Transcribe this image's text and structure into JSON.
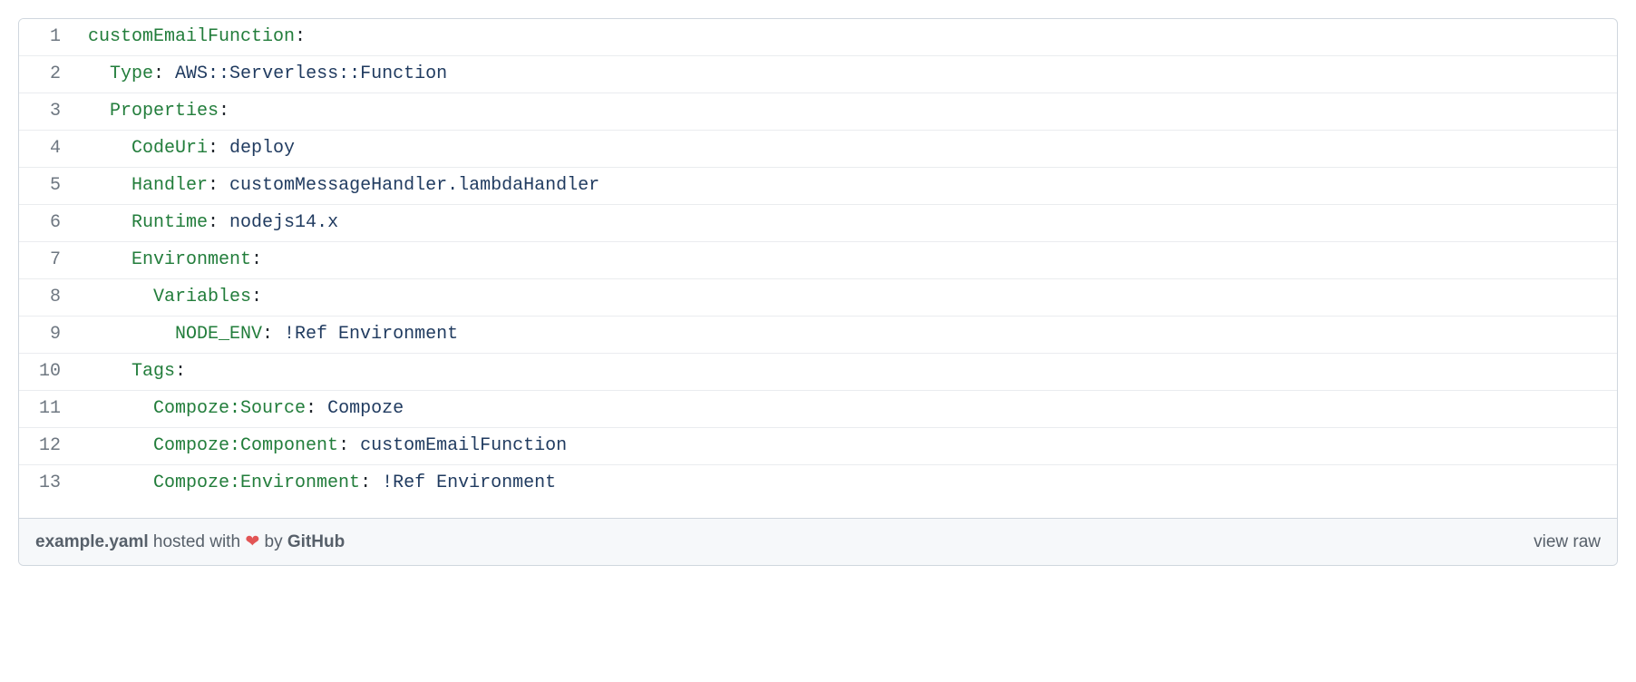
{
  "code": {
    "lines": [
      {
        "n": "1",
        "indent": "",
        "segments": [
          {
            "t": "customEmailFunction",
            "c": "pl-ent"
          },
          {
            "t": ":",
            "c": ""
          }
        ]
      },
      {
        "n": "2",
        "indent": "  ",
        "segments": [
          {
            "t": "Type",
            "c": "pl-ent"
          },
          {
            "t": ": ",
            "c": ""
          },
          {
            "t": "AWS::Serverless::Function",
            "c": "pl-s"
          }
        ]
      },
      {
        "n": "3",
        "indent": "  ",
        "segments": [
          {
            "t": "Properties",
            "c": "pl-ent"
          },
          {
            "t": ":",
            "c": ""
          }
        ]
      },
      {
        "n": "4",
        "indent": "    ",
        "segments": [
          {
            "t": "CodeUri",
            "c": "pl-ent"
          },
          {
            "t": ": ",
            "c": ""
          },
          {
            "t": "deploy",
            "c": "pl-s"
          }
        ]
      },
      {
        "n": "5",
        "indent": "    ",
        "segments": [
          {
            "t": "Handler",
            "c": "pl-ent"
          },
          {
            "t": ": ",
            "c": ""
          },
          {
            "t": "customMessageHandler.lambdaHandler",
            "c": "pl-s"
          }
        ]
      },
      {
        "n": "6",
        "indent": "    ",
        "segments": [
          {
            "t": "Runtime",
            "c": "pl-ent"
          },
          {
            "t": ": ",
            "c": ""
          },
          {
            "t": "nodejs14.x",
            "c": "pl-s"
          }
        ]
      },
      {
        "n": "7",
        "indent": "    ",
        "segments": [
          {
            "t": "Environment",
            "c": "pl-ent"
          },
          {
            "t": ":",
            "c": ""
          }
        ]
      },
      {
        "n": "8",
        "indent": "      ",
        "segments": [
          {
            "t": "Variables",
            "c": "pl-ent"
          },
          {
            "t": ":",
            "c": ""
          }
        ]
      },
      {
        "n": "9",
        "indent": "        ",
        "segments": [
          {
            "t": "NODE_ENV",
            "c": "pl-ent"
          },
          {
            "t": ": ",
            "c": ""
          },
          {
            "t": "!Ref Environment",
            "c": "pl-s"
          }
        ]
      },
      {
        "n": "10",
        "indent": "    ",
        "segments": [
          {
            "t": "Tags",
            "c": "pl-ent"
          },
          {
            "t": ":",
            "c": ""
          }
        ]
      },
      {
        "n": "11",
        "indent": "      ",
        "segments": [
          {
            "t": "Compoze:Source",
            "c": "pl-ent"
          },
          {
            "t": ": ",
            "c": ""
          },
          {
            "t": "Compoze",
            "c": "pl-s"
          }
        ]
      },
      {
        "n": "12",
        "indent": "      ",
        "segments": [
          {
            "t": "Compoze:Component",
            "c": "pl-ent"
          },
          {
            "t": ": ",
            "c": ""
          },
          {
            "t": "customEmailFunction",
            "c": "pl-s"
          }
        ]
      },
      {
        "n": "13",
        "indent": "      ",
        "segments": [
          {
            "t": "Compoze:Environment",
            "c": "pl-ent"
          },
          {
            "t": ": ",
            "c": ""
          },
          {
            "t": "!Ref Environment",
            "c": "pl-s"
          }
        ]
      }
    ]
  },
  "footer": {
    "filename": "example.yaml",
    "hosted_prefix": " hosted with ",
    "heart": "❤",
    "by_prefix": " by ",
    "host": "GitHub",
    "view_raw": "view raw"
  }
}
